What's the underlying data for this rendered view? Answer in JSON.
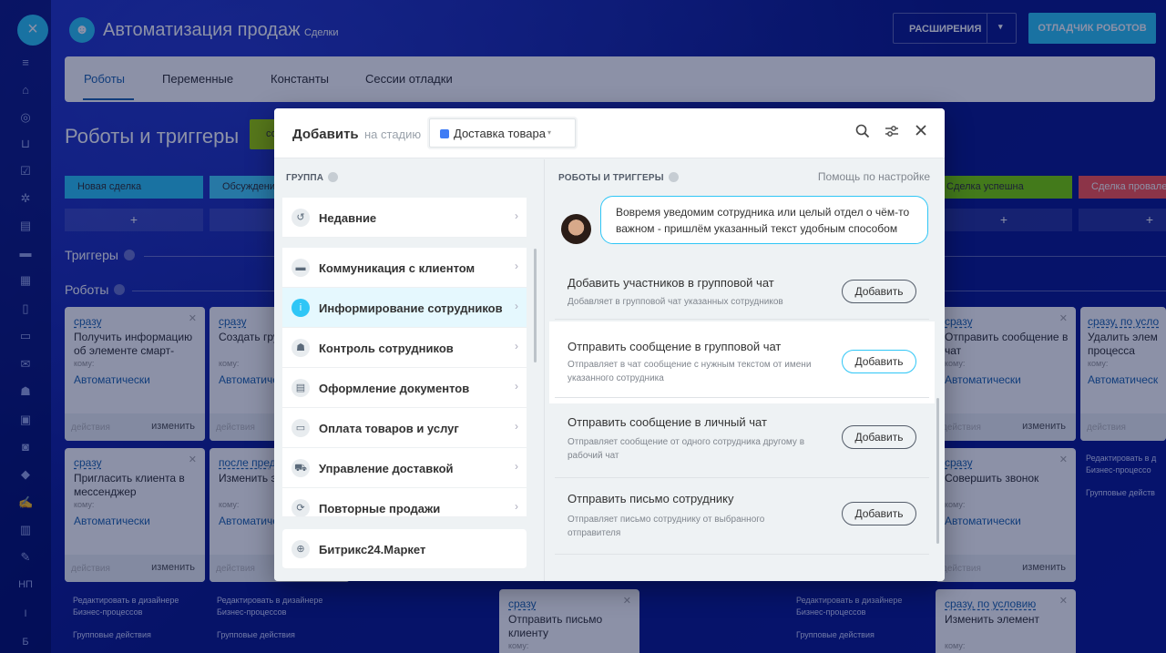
{
  "rail": {
    "items": [
      "filter-icon",
      "home-icon",
      "target-icon",
      "cart-icon",
      "checkbox-icon",
      "gear-icon",
      "list-icon",
      "chat-icon",
      "calendar-icon",
      "doc-icon",
      "inbox-icon",
      "mail-icon",
      "team-icon",
      "card-icon",
      "robot-icon",
      "box-icon",
      "sign-icon",
      "chart-icon",
      "edit-icon"
    ],
    "labels": [
      "НП",
      "I",
      "Б"
    ]
  },
  "header": {
    "title": "Автоматизация продаж",
    "subtitle": "Сделки",
    "extensions": "РАСШИРЕНИЯ",
    "debugger": "ОТЛАДЧИК РОБОТОВ"
  },
  "tabs": [
    "Роботы",
    "Переменные",
    "Константы",
    "Сессии отладки"
  ],
  "page": {
    "title": "Роботы и триггеры",
    "green_btn": "со",
    "triggers": "Триггеры",
    "robots": "Роботы"
  },
  "stages": {
    "new": "Новая сделка",
    "discuss": "Обсуждение",
    "success": "Сделка успешна",
    "fail": "Сделка провалена",
    "plus": "+"
  },
  "cards": [
    {
      "when": "сразу",
      "text": "Получить информацию об элементе смарт-",
      "who": "кому:",
      "auto": "Автоматически",
      "actions": "действия",
      "edit": "изменить"
    },
    {
      "when": "сразу",
      "text": "Создать гру",
      "who": "кому:",
      "auto": "Автоматиче",
      "actions": "действия",
      "edit": ""
    },
    {
      "when": "сразу",
      "text": "Отправить сообщение в чат",
      "who": "кому:",
      "auto": "Автоматически",
      "actions": "действия",
      "edit": "изменить"
    },
    {
      "when": "сразу, по усло",
      "text": "Удалить элем процесса",
      "who": "кому:",
      "auto": "Автоматическ",
      "actions": "действия",
      "edit": ""
    },
    {
      "when": "сразу",
      "text": "Пригласить клиента в мессенджер",
      "who": "кому:",
      "auto": "Автоматически",
      "actions": "действия",
      "edit": "изменить"
    },
    {
      "when": "после пред",
      "text": "Изменить э",
      "who": "кому:",
      "auto": "Автоматиче",
      "actions": "действия",
      "edit": ""
    },
    {
      "when": "сразу",
      "text": "Совершить звонок",
      "who": "кому:",
      "auto": "Автоматически",
      "actions": "действия",
      "edit": "изменить"
    },
    {
      "when": "сразу",
      "text": "Отправить письмо клиенту",
      "who": "кому:",
      "auto": "",
      "actions": "",
      "edit": ""
    },
    {
      "when": "сразу, по условию",
      "text": "Изменить элемент",
      "who": "кому:",
      "auto": "",
      "actions": "",
      "edit": ""
    }
  ],
  "footer_links": {
    "designer": "Редактировать в дизайнере Бизнес-процессов",
    "group": "Групповые действия",
    "designer_short": "Редактировать в д Бизнес-процессо",
    "group_short": "Групповые действ"
  },
  "modal": {
    "title": "Добавить",
    "stage_label": "на стадию",
    "stage_value": "Доставка товара",
    "group_header": "ГРУППА",
    "robots_header": "РОБОТЫ И ТРИГГЕРЫ",
    "help": "Помощь по настройке",
    "groups": [
      "Недавние",
      "Коммуникация с клиентом",
      "Информирование сотрудников",
      "Контроль сотрудников",
      "Оформление документов",
      "Оплата товаров и услуг",
      "Управление доставкой",
      "Повторные продажи",
      "Битрикс24.Маркет"
    ],
    "bubble": "Вовремя уведомим сотрудника или целый отдел о чём-то важном - пришлём указанный текст удобным способом",
    "robots": [
      {
        "title": "Добавить участников в групповой чат",
        "desc": "Добавляет в групповой чат указанных сотрудников",
        "add": "Добавить"
      },
      {
        "title": "Отправить сообщение в групповой чат",
        "desc": "Отправляет в чат сообщение с нужным текстом от имени указанного сотрудника",
        "add": "Добавить"
      },
      {
        "title": "Отправить сообщение в личный чат",
        "desc": "Отправляет сообщение от одного сотрудника другому в рабочий чат",
        "add": "Добавить"
      },
      {
        "title": "Отправить письмо сотруднику",
        "desc": "Отправляет письмо сотруднику от выбранного отправителя",
        "add": "Добавить"
      }
    ]
  },
  "colors": {
    "accent": "#2fc6f6",
    "link": "#2067b0",
    "green": "#9dcf00",
    "red": "#ff5752"
  }
}
